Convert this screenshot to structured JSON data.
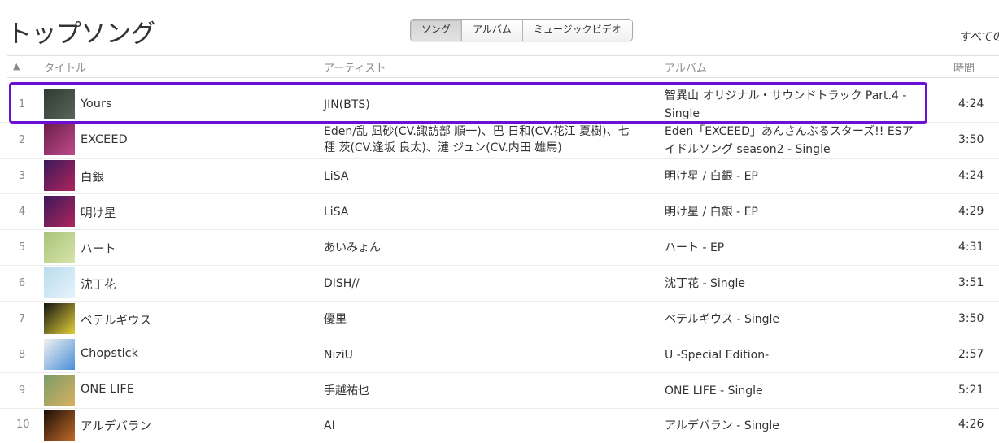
{
  "page": {
    "title": "トップソング",
    "see_all": "すべての"
  },
  "segments": [
    {
      "label": "ソング",
      "active": true
    },
    {
      "label": "アルバム",
      "active": false
    },
    {
      "label": "ミュージックビデオ",
      "active": false
    }
  ],
  "columns": {
    "sort": "▲",
    "title": "タイトル",
    "artist": "アーティスト",
    "album": "アルバム",
    "time": "時間"
  },
  "rows": [
    {
      "num": "1",
      "name": "Yours",
      "artist": "JIN(BTS)",
      "album": "智異山 オリジナル・サウンドトラック Part.4 - Single",
      "time": "4:24",
      "art": [
        "#2f3a30",
        "#59655a"
      ]
    },
    {
      "num": "2",
      "name": "EXCEED",
      "artist": "Eden/乱 凪砂(CV.諏訪部 順一)、巴 日和(CV.花江 夏樹)、七種 茨(CV.逢坂 良太)、漣 ジュン(CV.内田 雄馬)",
      "album": "Eden「EXCEED」あんさんぶるスターズ!! ESアイドルソング season2 - Single",
      "time": "3:50",
      "art": [
        "#6b1f4a",
        "#c04a8a"
      ]
    },
    {
      "num": "3",
      "name": "白銀",
      "artist": "LiSA",
      "album": "明け星 / 白銀 - EP",
      "time": "4:24",
      "art": [
        "#3a1a5a",
        "#b0245c"
      ]
    },
    {
      "num": "4",
      "name": "明け星",
      "artist": "LiSA",
      "album": "明け星 / 白銀 - EP",
      "time": "4:29",
      "art": [
        "#3a1a5a",
        "#b0245c"
      ]
    },
    {
      "num": "5",
      "name": "ハート",
      "artist": "あいみょん",
      "album": "ハート - EP",
      "time": "4:31",
      "art": [
        "#a7c479",
        "#d7e3a8"
      ]
    },
    {
      "num": "6",
      "name": "沈丁花",
      "artist": "DISH//",
      "album": "沈丁花 - Single",
      "time": "3:51",
      "art": [
        "#b9dcee",
        "#e6f3fa"
      ]
    },
    {
      "num": "7",
      "name": "ベテルギウス",
      "artist": "優里",
      "album": "ベテルギウス - Single",
      "time": "3:50",
      "art": [
        "#141414",
        "#e3d038"
      ]
    },
    {
      "num": "8",
      "name": "Chopstick",
      "artist": "NiziU",
      "album": "U -Special Edition-",
      "time": "2:57",
      "art": [
        "#f0f0f0",
        "#4a8fd8"
      ]
    },
    {
      "num": "9",
      "name": "ONE LIFE",
      "artist": "手越祐也",
      "album": "ONE LIFE - Single",
      "time": "5:21",
      "art": [
        "#7a9c6a",
        "#d8b060"
      ]
    },
    {
      "num": "10",
      "name": "アルデバラン",
      "artist": "AI",
      "album": "アルデバラン - Single",
      "time": "4:26",
      "art": [
        "#1a0e08",
        "#c06a28"
      ]
    }
  ]
}
